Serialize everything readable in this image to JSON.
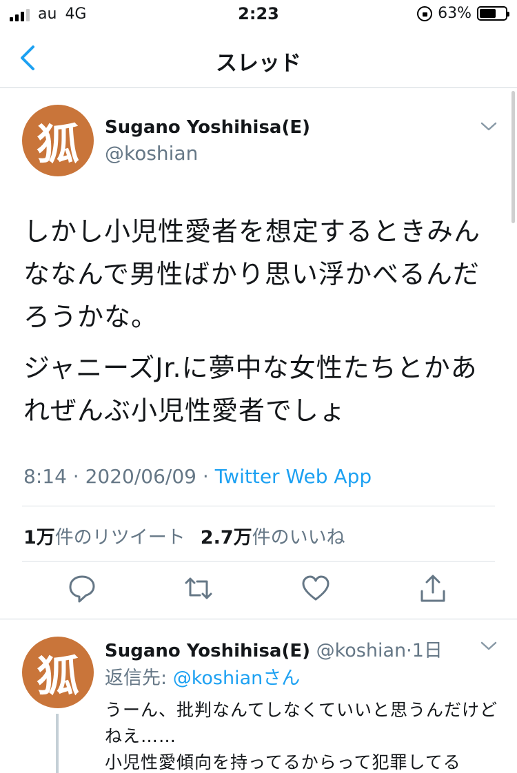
{
  "status_bar": {
    "carrier": "au",
    "network": "4G",
    "time": "2:23",
    "battery_percent": "63%",
    "battery_level": 0.63
  },
  "nav": {
    "title": "スレッド",
    "back_icon": "chevron-left-icon"
  },
  "tweet": {
    "avatar_glyph": "狐",
    "display_name": "Sugano Yoshihisa(E)",
    "handle": "@koshian",
    "text_paragraph_1": "しかし小児性愛者を想定するときみんななんで男性ばかり思い浮かべるんだろうかな。",
    "text_paragraph_2": "ジャニーズJr.に夢中な女性たちとかあれぜんぶ小児性愛者でしょ",
    "time": "8:14",
    "separator": "·",
    "date": "2020/06/09",
    "source": "Twitter Web App",
    "retweets_count": "1万",
    "retweets_label": "件のリツイート",
    "likes_count": "2.7万",
    "likes_label": "件のいいね",
    "actions": [
      "reply-icon",
      "retweet-icon",
      "like-icon",
      "share-icon"
    ]
  },
  "reply": {
    "avatar_glyph": "狐",
    "display_name": "Sugano Yoshihisa(E)",
    "handle": "@koshian",
    "age": "1日",
    "reply_to_label": "返信先:",
    "reply_to_link": "@koshianさん",
    "text_line_1": "うーん、批判なんてしなくていいと思うんだけどねえ……",
    "text_line_2": "小児性愛傾向を持ってるからって犯罪してる"
  },
  "colors": {
    "accent": "#1da1f2",
    "secondary_text": "#657786",
    "avatar_bg": "#c9753a"
  }
}
